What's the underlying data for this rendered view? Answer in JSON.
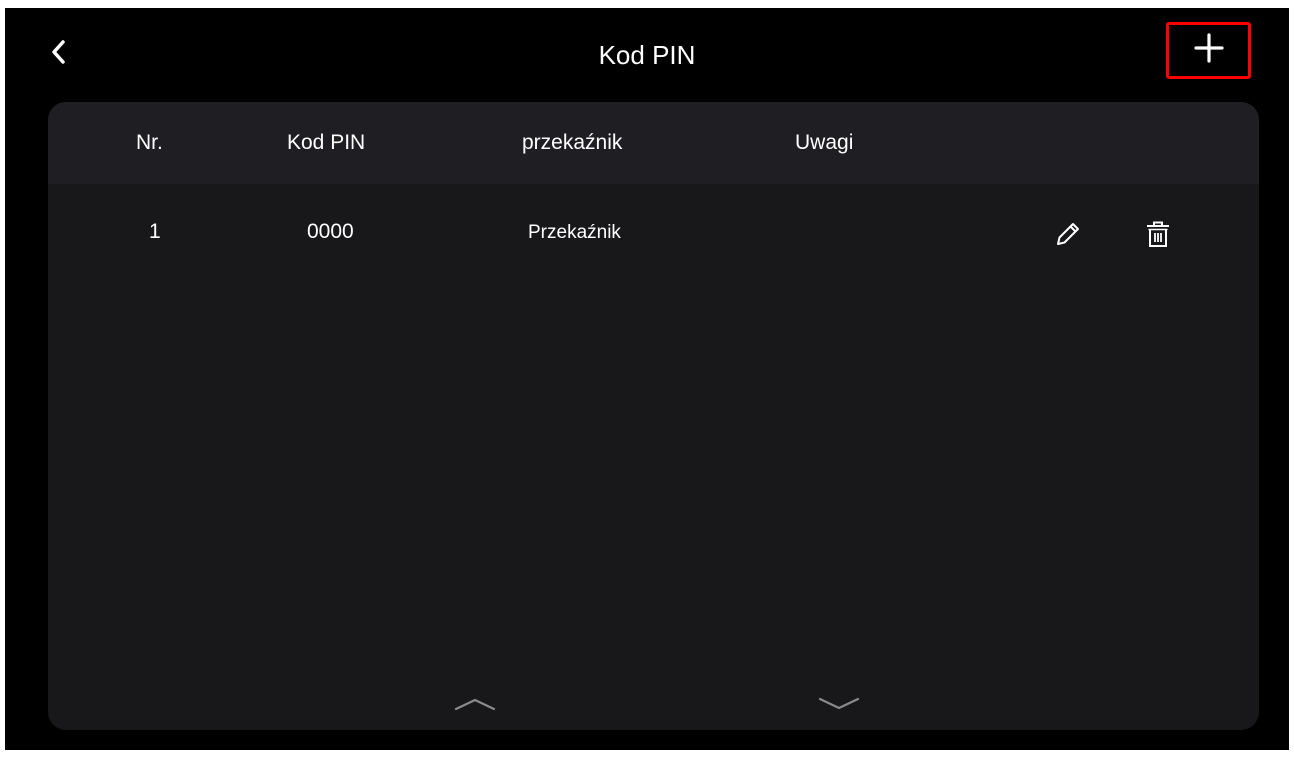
{
  "header": {
    "title": "Kod PIN",
    "back_icon": "chevron-left-icon",
    "add_icon": "plus-icon",
    "highlight_color": "#ff0000"
  },
  "table": {
    "columns": [
      "Nr.",
      "Kod PIN",
      "przekaźnik",
      "Uwagi"
    ],
    "rows": [
      {
        "nr": "1",
        "pin": "0000",
        "relay": "Przekaźnik",
        "notes": "",
        "edit_icon": "pencil-icon",
        "delete_icon": "trash-icon"
      }
    ]
  },
  "pager": {
    "up_icon": "chevron-up-icon",
    "down_icon": "chevron-down-icon"
  },
  "colors": {
    "background": "#000000",
    "panel": "#18181b",
    "table_header": "#1f1f23",
    "text": "#ffffff",
    "pager_icon": "#8a8a8a"
  }
}
